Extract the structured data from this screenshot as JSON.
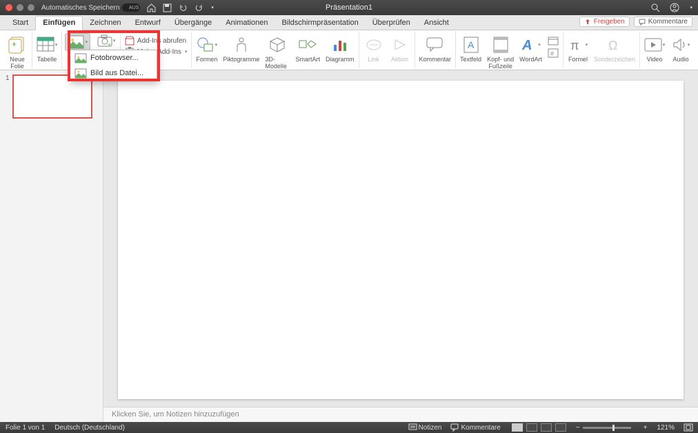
{
  "titlebar": {
    "autosave_label": "Automatisches Speichern",
    "autosave_toggle": "AUS",
    "document_title": "Präsentation1"
  },
  "tabs": {
    "items": [
      "Start",
      "Einfügen",
      "Zeichnen",
      "Entwurf",
      "Übergänge",
      "Animationen",
      "Bildschirmpräsentation",
      "Überprüfen",
      "Ansicht"
    ],
    "active_index": 1,
    "share": "Freigeben",
    "comments": "Kommentare"
  },
  "ribbon": {
    "new_slide": "Neue\nFolie",
    "table": "Tabelle",
    "addins_get": "Add-Ins abrufen",
    "addins_my": "Meine Add-Ins",
    "shapes": "Formen",
    "icons": "Piktogramme",
    "models": "3D-Modelle",
    "smartart": "SmartArt",
    "chart": "Diagramm",
    "link": "Link",
    "action": "Aktion",
    "comment": "Kommentar",
    "textbox": "Textfeld",
    "headerfooter": "Kopf- und\nFußzeile",
    "wordart": "WordArt",
    "equation": "Formel",
    "symbol": "Sonderzeichen",
    "video": "Video",
    "audio": "Audio"
  },
  "dropdown": {
    "item1": "Fotobrowser...",
    "item2": "Bild aus Datei..."
  },
  "thumbs": {
    "slide1_number": "1"
  },
  "notes_placeholder": "Klicken Sie, um Notizen hinzuzufügen",
  "status": {
    "slide_info": "Folie 1 von 1",
    "language": "Deutsch (Deutschland)",
    "notes_btn": "Notizen",
    "comments_btn": "Kommentare",
    "zoom_pct": "121%",
    "zoom_minus": "−",
    "zoom_plus": "+"
  }
}
